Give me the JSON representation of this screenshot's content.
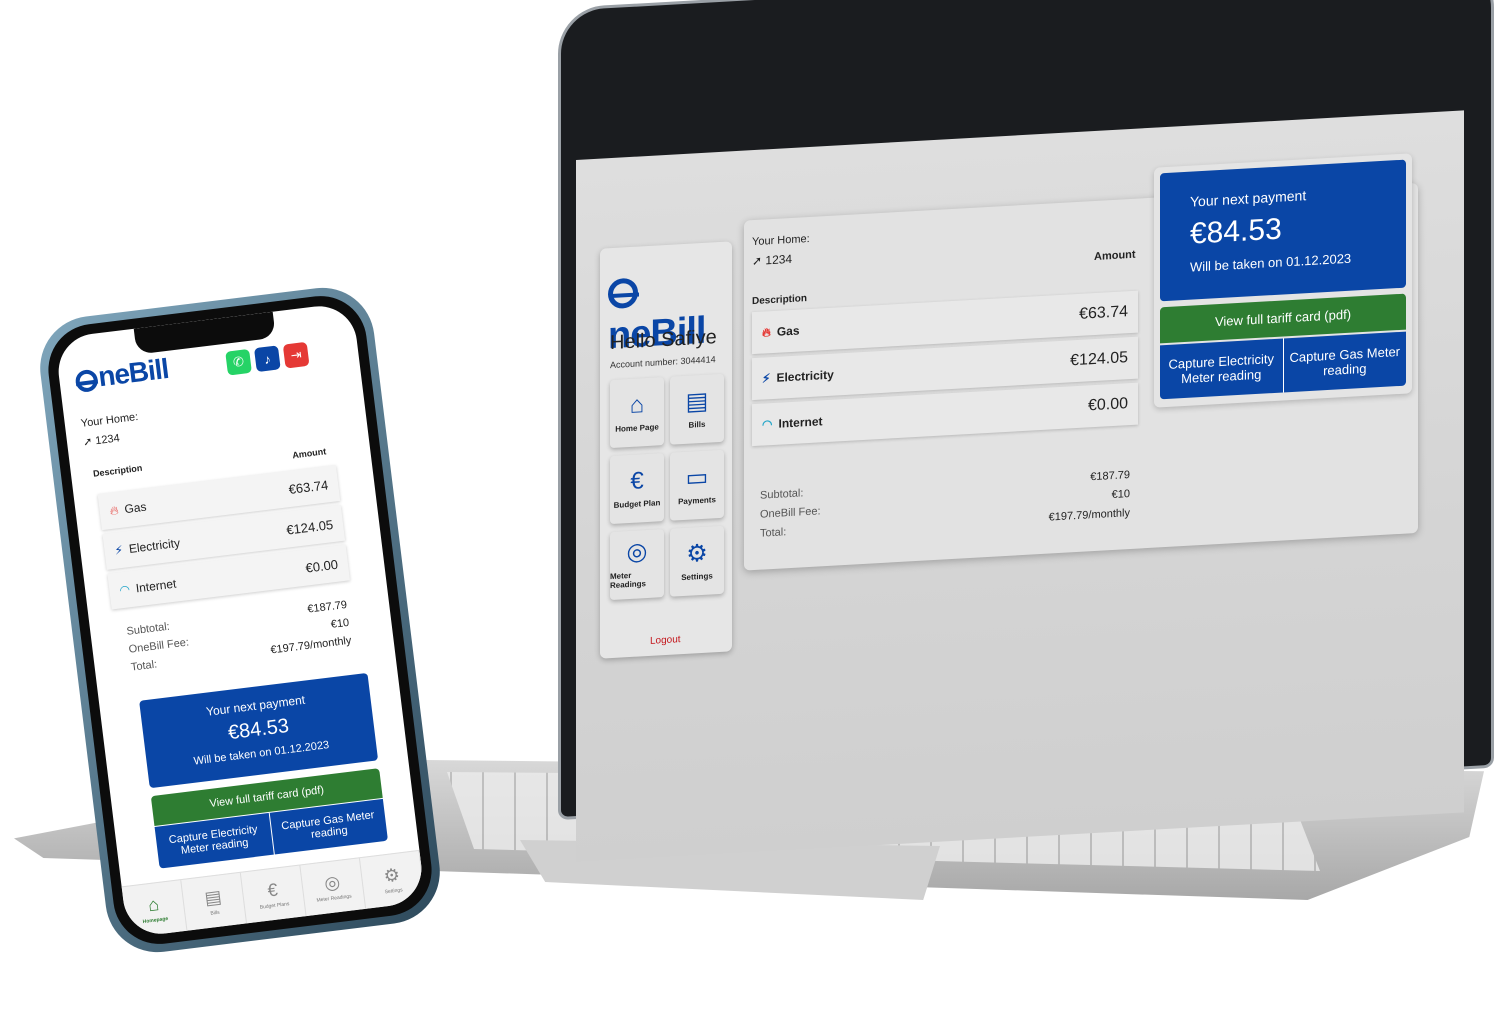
{
  "app": {
    "logo_text": "neBill",
    "greeting": "Hello Safiye",
    "account_number": "Account number: 3044414"
  },
  "colors": {
    "brand_blue": "#0a46a6",
    "green": "#2e7d32",
    "logout_red": "#c4161c",
    "gas_red": "#e53935",
    "electricity_blue": "#0a46a6",
    "internet_teal": "#26a6c9"
  },
  "nav": [
    {
      "label": "Home Page",
      "icon": "house-icon"
    },
    {
      "label": "Bills",
      "icon": "bill-icon"
    },
    {
      "label": "Budget Plan",
      "icon": "euro-icon"
    },
    {
      "label": "Payments",
      "icon": "card-icon"
    },
    {
      "label": "Meter Readings",
      "icon": "meter-icon"
    },
    {
      "label": "Settings",
      "icon": "gear-icon"
    }
  ],
  "logout": "Logout",
  "home": {
    "label": "Your Home:",
    "value": "1234"
  },
  "table": {
    "desc_header": "Description",
    "amount_header": "Amount",
    "rows": [
      {
        "name": "Gas",
        "amount": "€63.74",
        "icon": "flame-icon"
      },
      {
        "name": "Electricity",
        "amount": "€124.05",
        "icon": "bolt-icon"
      },
      {
        "name": "Internet",
        "amount": "€0.00",
        "icon": "wifi-icon"
      }
    ]
  },
  "summary": {
    "subtotal_label": "Subtotal:",
    "subtotal": "€187.79",
    "fee_label": "OneBill Fee:",
    "fee": "€10",
    "total_label": "Total:",
    "total": "€197.79/monthly"
  },
  "payment": {
    "title": "Your next payment",
    "amount": "€84.53",
    "date": "Will be taken on 01.12.2023"
  },
  "actions": {
    "tariff": "View full tariff card (pdf)",
    "capture_electricity": "Capture Electricity Meter reading",
    "capture_gas": "Capture Gas Meter reading"
  },
  "phone_header_icons": [
    "whatsapp-icon",
    "bell-icon",
    "logout-icon"
  ],
  "tabbar": [
    {
      "label": "Homepage",
      "icon": "house-icon",
      "active": true
    },
    {
      "label": "Bills",
      "icon": "bill-icon"
    },
    {
      "label": "Budget Plans",
      "icon": "euro-icon"
    },
    {
      "label": "Meter Readings",
      "icon": "meter-icon"
    },
    {
      "label": "Settings",
      "icon": "gear-icon"
    }
  ]
}
